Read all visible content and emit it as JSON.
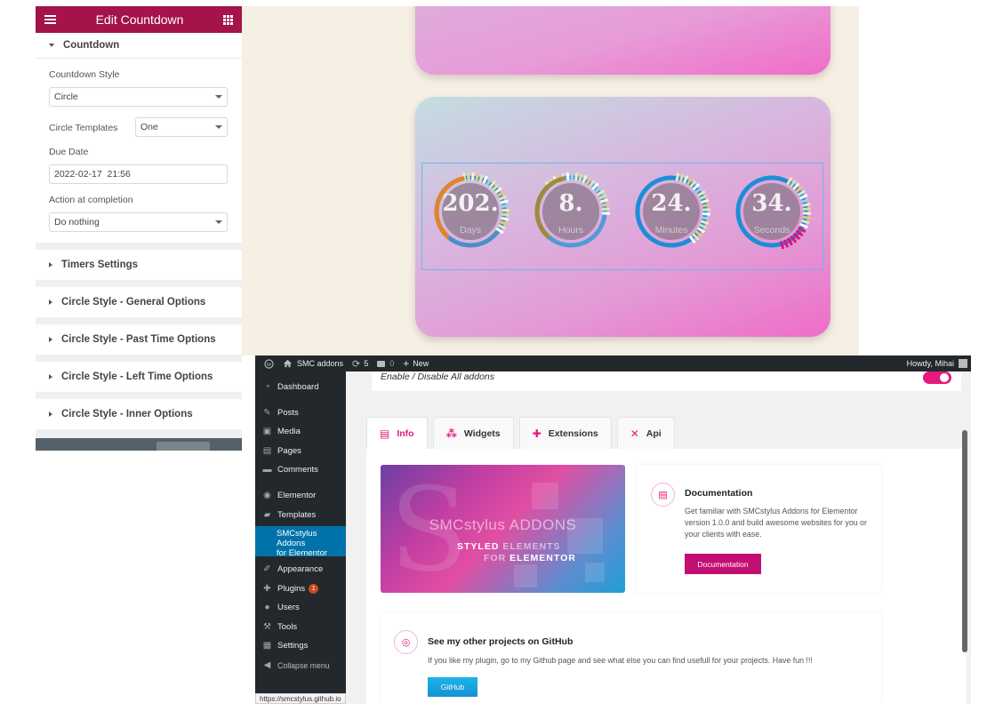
{
  "elementor": {
    "header_title": "Edit Countdown",
    "section_title": "Countdown",
    "countdown_style": {
      "label": "Countdown Style",
      "value": "Circle"
    },
    "circle_templates": {
      "label": "Circle Templates",
      "value": "One"
    },
    "due_date": {
      "label": "Due Date",
      "value": "2022-02-17  21:56"
    },
    "action": {
      "label": "Action at completion",
      "value": "Do nothing"
    },
    "collapsed_sections": [
      "Timers Settings",
      "Circle Style - General Options",
      "Circle Style - Past Time Options",
      "Circle Style - Left Time Options",
      "Circle Style - Inner Options"
    ],
    "accent": "#a4134a"
  },
  "countdown": [
    {
      "value": "202.",
      "unit": "Days"
    },
    {
      "value": "8.",
      "unit": "Hours"
    },
    {
      "value": "24.",
      "unit": "Minutes"
    },
    {
      "value": "34.",
      "unit": "Seconds"
    }
  ],
  "wp": {
    "adminbar": {
      "site_name": "SMC addons",
      "updates": "5",
      "comments": "0",
      "new_label": "New",
      "howdy": "Howdy, Mihai"
    },
    "sidebar": {
      "dashboard": "Dashboard",
      "posts": "Posts",
      "media": "Media",
      "pages": "Pages",
      "comments": "Comments",
      "elementor": "Elementor",
      "templates": "Templates",
      "smc_line1": "SMCstylus Addons",
      "smc_line2": "for Elementor",
      "appearance": "Appearance",
      "plugins": "Plugins",
      "plugins_badge": "1",
      "users": "Users",
      "tools": "Tools",
      "settings": "Settings",
      "collapse": "Collapse menu"
    },
    "toggle_label": "Enable / Disable All addons",
    "tabs": [
      "Info",
      "Widgets",
      "Extensions",
      "Api"
    ],
    "banner": {
      "brand": "SMCstylus ADDONS",
      "styled": "STYLED",
      "elements": "ELEMENTS",
      "for": "FOR",
      "elementor": "ELEMENTOR"
    },
    "documentation": {
      "title": "Documentation",
      "text": "Get familiar with SMCstylus Addons for Elementor version 1.0.0 and build awesome websites for you or your clients with ease.",
      "button": "Documentation"
    },
    "github": {
      "title": "See my other projects on GitHub",
      "text": "If you like my plugin, go to my Github page and see what else you can find usefull for your projects. Have fun !!!",
      "button": "GitHub"
    },
    "status_url": "https://smcstylus.github.io",
    "accent": "#e41a7d"
  }
}
